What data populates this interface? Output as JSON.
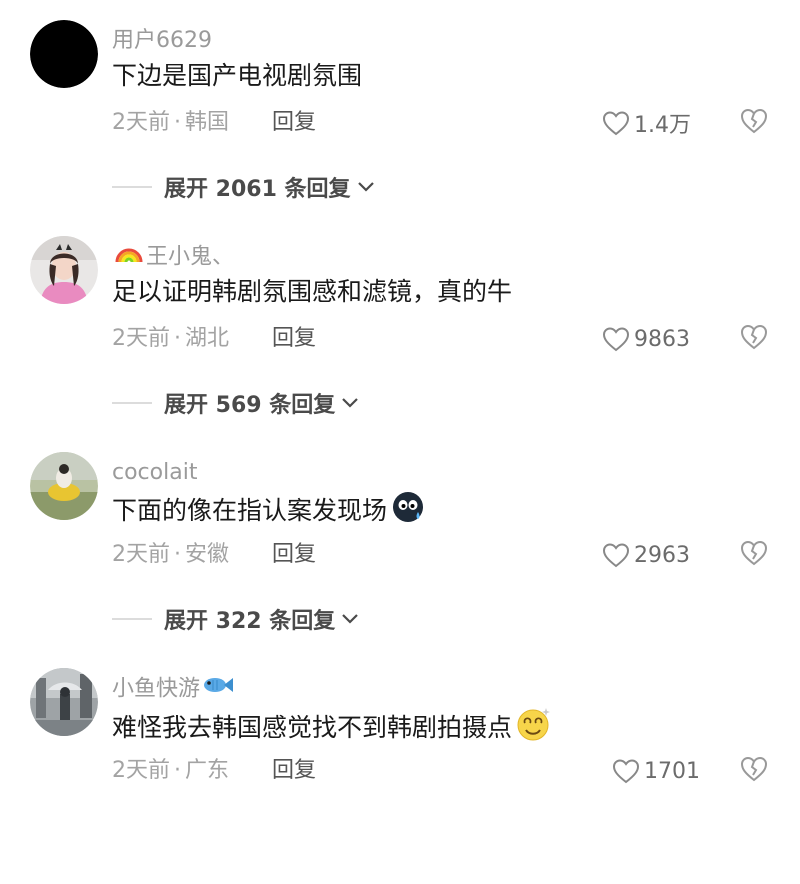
{
  "comments": [
    {
      "username": "用户6629",
      "text": "下边是国产电视剧氛围",
      "time": "2天前",
      "location": "韩国",
      "reply_label": "回复",
      "likes": "1.4万",
      "expand_label": "展开 2061 条回复",
      "avatar": "black-circle-avatar"
    },
    {
      "username": "王小鬼、",
      "username_badge": "rainbow-icon",
      "text": "足以证明韩剧氛围感和滤镜，真的牛",
      "time": "2天前",
      "location": "湖北",
      "reply_label": "回复",
      "likes": "9863",
      "expand_label": "展开 569 条回复",
      "avatar": "girl-photo-avatar"
    },
    {
      "username": "cocolait",
      "text": "下面的像在指认案发现场",
      "text_emoji": "sweat-face-emoji",
      "time": "2天前",
      "location": "安徽",
      "reply_label": "回复",
      "likes": "2963",
      "expand_label": "展开 322 条回复",
      "avatar": "outdoor-photo-avatar"
    },
    {
      "username": "小鱼快游",
      "username_badge": "fish-icon",
      "text": "难怪我去韩国感觉找不到韩剧拍摄点",
      "text_emoji": "dizzy-smile-emoji",
      "time": "2天前",
      "location": "广东",
      "reply_label": "回复",
      "likes": "1701",
      "avatar": "street-photo-avatar"
    }
  ],
  "meta_separator": "·",
  "colors": {
    "text": "#1a1a1a",
    "muted": "#a3a3a3",
    "username": "#9a9a9a",
    "expand": "#4a4a4a"
  }
}
